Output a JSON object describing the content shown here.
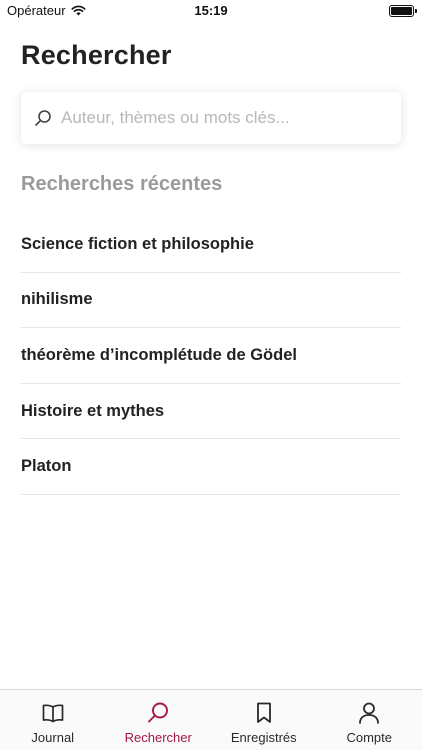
{
  "status_bar": {
    "carrier": "Opérateur",
    "time": "15:19"
  },
  "page": {
    "title": "Rechercher"
  },
  "search": {
    "placeholder": "Auteur, thèmes ou mots clés...",
    "value": ""
  },
  "recent": {
    "title": "Recherches récentes",
    "items": [
      "Science fiction et philosophie",
      "nihilisme",
      "théorème d’incomplétude de Gödel",
      "Histoire et mythes",
      "Platon"
    ]
  },
  "tab_bar": {
    "active": "Rechercher",
    "active_color": "#a3164a",
    "items": [
      {
        "label": "Journal",
        "icon": "book-icon"
      },
      {
        "label": "Rechercher",
        "icon": "search-icon"
      },
      {
        "label": "Enregistrés",
        "icon": "bookmark-icon"
      },
      {
        "label": "Compte",
        "icon": "person-icon"
      }
    ]
  }
}
